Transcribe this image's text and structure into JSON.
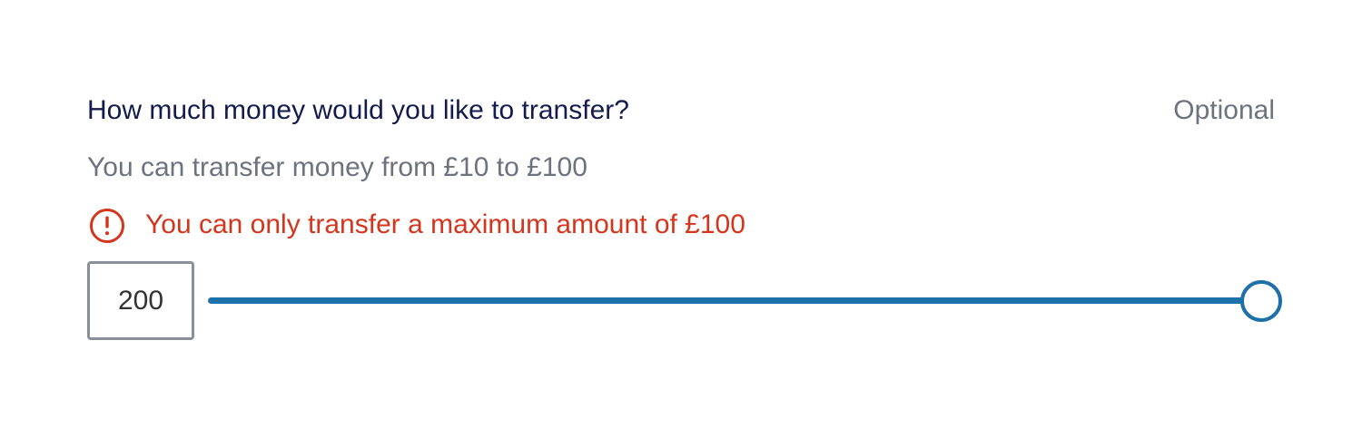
{
  "field": {
    "label": "How much money would you like to transfer?",
    "optional_label": "Optional",
    "hint": "You can transfer money from £10 to £100",
    "error": {
      "icon": "exclamation-circle-icon",
      "message": "You can only transfer a maximum amount of £100"
    },
    "input": {
      "value": "200"
    },
    "slider": {
      "min": 10,
      "max": 100,
      "value": 100,
      "fill_fraction": 1.0
    }
  },
  "colors": {
    "label": "#141b4d",
    "muted": "#6e727e",
    "error": "#d4351c",
    "accent": "#1d70a8",
    "input_border": "#8a8f99"
  }
}
